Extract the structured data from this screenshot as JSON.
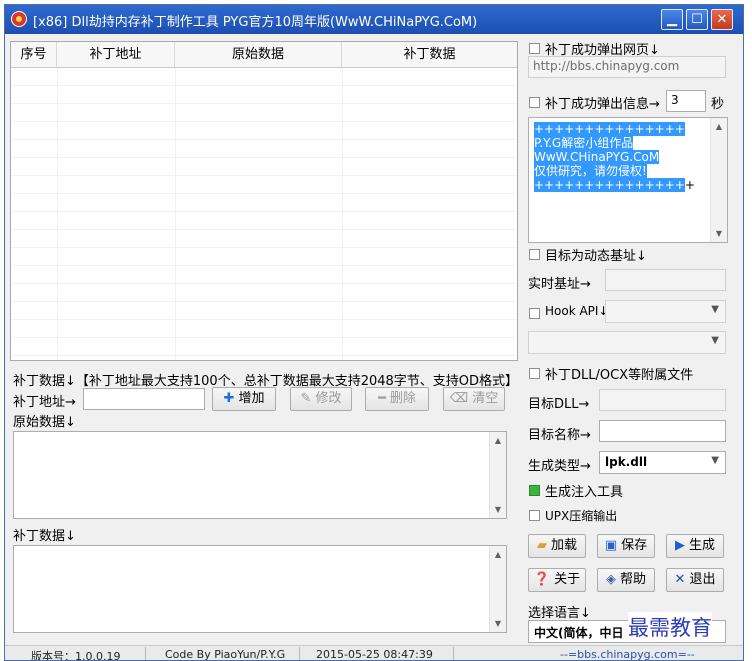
{
  "titlebar": {
    "title": "[x86] Dll劫持内存补丁制作工具  PYG官方10周年版(WwW.CHiNaPYG.CoM)",
    "min_glyph": "▁",
    "max_glyph": "☐",
    "close_glyph": "✕"
  },
  "grid": {
    "columns": [
      "序号",
      "补丁地址",
      "原始数据",
      "补丁数据"
    ]
  },
  "left": {
    "patch_header": "补丁数据↓【补丁地址最大支持100个、总补丁数据最大支持2048字节、支持OD格式】",
    "patch_addr_label": "补丁地址→",
    "patch_addr_value": "",
    "add_button": "增加",
    "modify_button": "修改",
    "delete_button": "删除",
    "clear_button": "清空",
    "orig_data_label": "原始数据↓",
    "orig_data_value": "",
    "patch_data_label": "补丁数据↓",
    "patch_data_value": ""
  },
  "right": {
    "popup_web_label": "补丁成功弹出网页↓",
    "popup_web_url": "http://bbs.chinapyg.com",
    "popup_info_label": "补丁成功弹出信息→",
    "popup_info_seconds": "3",
    "popup_info_unit": "秒",
    "info_lines": [
      "+++++++++++++++",
      "P.Y.G解密小组作品",
      "WwW.CHinaPYG.CoM",
      "仅供研究，请勿侵权!",
      "+++++++++++++++"
    ],
    "info_caret_char": "+",
    "dynamic_base_label": "目标为动态基址↓",
    "real_base_label": "实时基址→",
    "real_base_value": "",
    "hook_api_label": "Hook API↓",
    "hook_api_value": "",
    "hook_api_sub_value": "",
    "attach_files_label": "补丁DLL/OCX等附属文件",
    "target_dll_label": "目标DLL→",
    "target_dll_value": "",
    "target_name_label": "目标名称→",
    "target_name_value": "",
    "gen_type_label": "生成类型→",
    "gen_type_value": "lpk.dll",
    "gen_inject_label": "生成注入工具",
    "upx_label": "UPX压缩输出",
    "load_button": "加载",
    "save_button": "保存",
    "generate_button": "生成",
    "about_button": "关于",
    "help_button": "帮助",
    "exit_button": "退出",
    "language_label": "选择语言↓",
    "language_value": "中文(简体，中日"
  },
  "statusbar": {
    "version": "版本号：1.0.0.19",
    "code_by": "Code By PiaoYun/P.Y.G",
    "datetime": "2015-05-25 08:47:39",
    "site": "--=bbs.chinapyg.com=--"
  },
  "watermark": "最需教育",
  "colors": {
    "titlebar": "#1f56b8",
    "selection": "#3399ff",
    "checked_green": "#3ab53a",
    "watermark": "#2d3fb8"
  }
}
